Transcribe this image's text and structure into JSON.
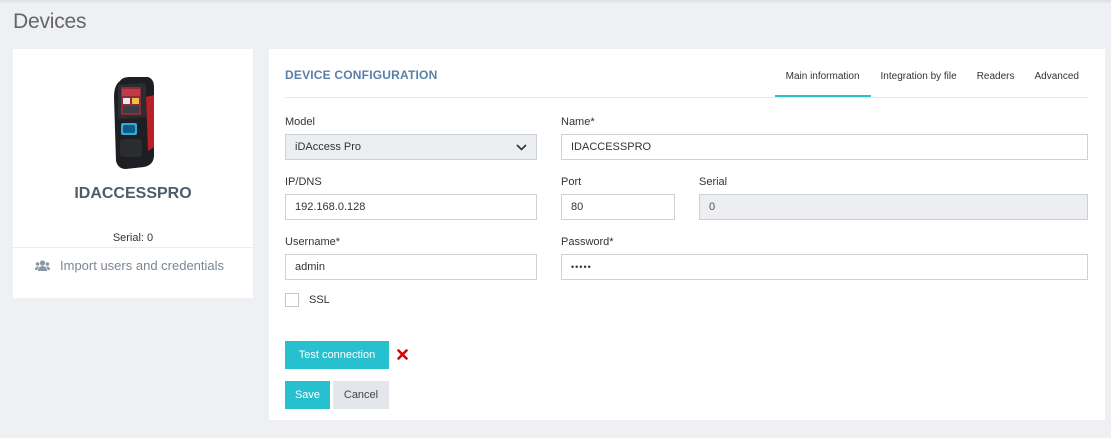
{
  "page": {
    "title": "Devices"
  },
  "device": {
    "name": "IDACCESSPRO",
    "serial_text": "Serial: 0",
    "import_label": "Import users and credentials",
    "import_icon": "users-icon"
  },
  "panel": {
    "title": "DEVICE CONFIGURATION",
    "tabs": [
      {
        "label": "Main information",
        "active": true
      },
      {
        "label": "Integration by file",
        "active": false
      },
      {
        "label": "Readers",
        "active": false
      },
      {
        "label": "Advanced",
        "active": false
      }
    ]
  },
  "form": {
    "model": {
      "label": "Model",
      "value": "iDAccess Pro"
    },
    "name": {
      "label": "Name*",
      "value": "IDACCESSPRO"
    },
    "ip": {
      "label": "IP/DNS",
      "value": "192.168.0.128"
    },
    "port": {
      "label": "Port",
      "value": "80"
    },
    "serial": {
      "label": "Serial",
      "value": "0"
    },
    "username": {
      "label": "Username*",
      "value": "admin"
    },
    "password": {
      "label": "Password*",
      "value": "•••••"
    },
    "ssl": {
      "label": "SSL",
      "checked": false
    }
  },
  "actions": {
    "test_connection": "Test connection",
    "connection_status_icon": "error-x-icon",
    "status_color": "#e00000",
    "save": "Save",
    "cancel": "Cancel"
  },
  "colors": {
    "accent": "#26c0cf",
    "title": "#5a7fa8"
  }
}
